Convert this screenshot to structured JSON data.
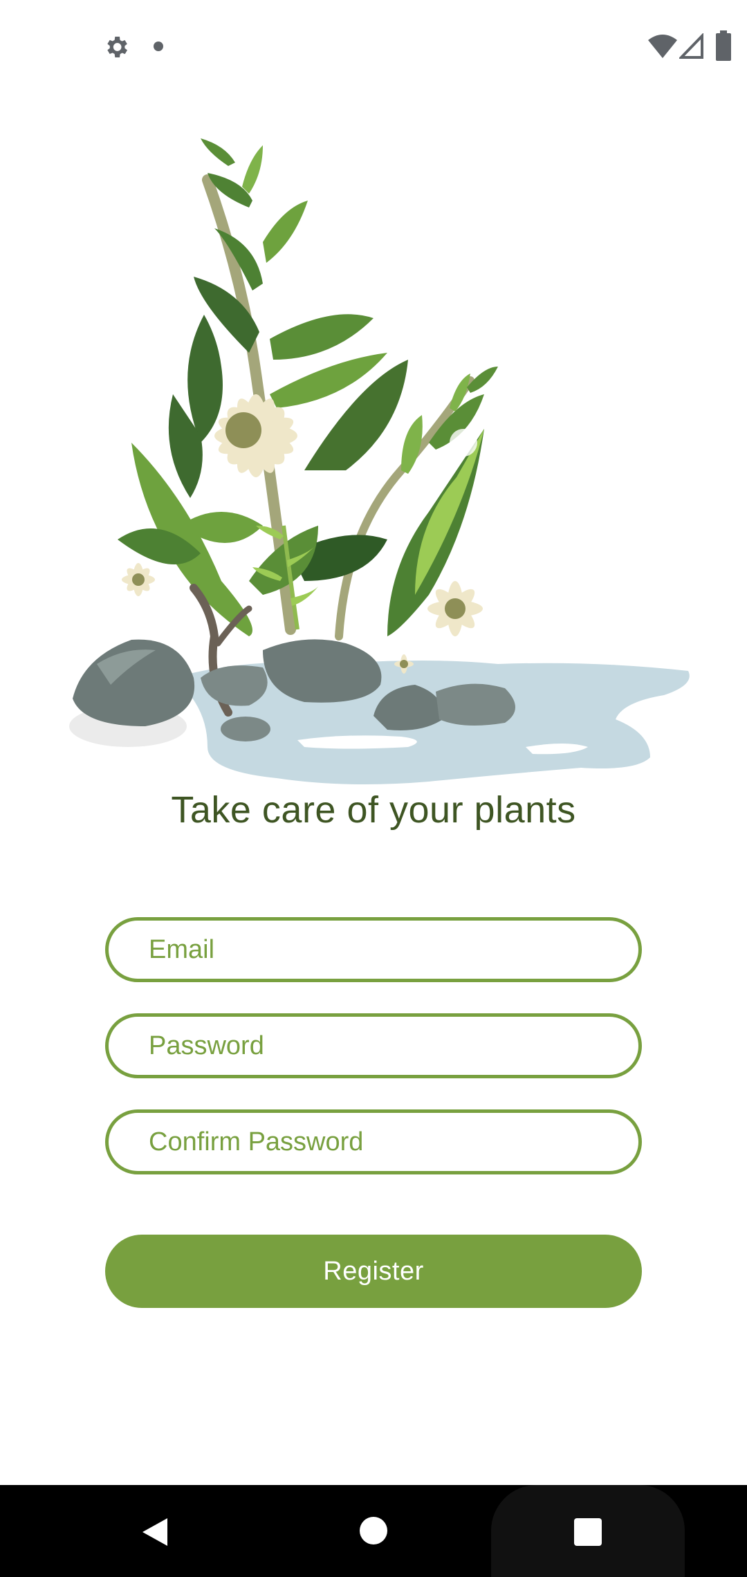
{
  "status_bar": {
    "left_icons": [
      "gear-icon",
      "notification-dot-icon"
    ],
    "right_icons": [
      "wifi-icon",
      "cellular-signal-icon",
      "battery-icon"
    ]
  },
  "hero": {
    "illustration": "plants-rocks-water-illustration"
  },
  "title": "Take care of your plants",
  "form": {
    "email_placeholder": "Email",
    "password_placeholder": "Password",
    "confirm_password_placeholder": "Confirm Password",
    "register_label": "Register"
  },
  "nav_bar": {
    "buttons": [
      "back-icon",
      "home-icon",
      "recents-icon"
    ]
  },
  "colors": {
    "accent": "#78a03f",
    "title_text": "#3e5523",
    "water": "#c5d9e1"
  }
}
